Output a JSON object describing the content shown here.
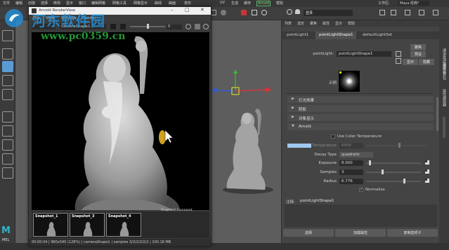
{
  "menubar": {
    "items": [
      "文件",
      "编辑",
      "创建",
      "选择",
      "修改",
      "显示",
      "窗口",
      "编辑网格",
      "网格工具",
      "网格显示",
      "曲线",
      "曲面",
      "变形",
      "UV",
      "生成",
      "缓存",
      "Arnold",
      "帮助"
    ],
    "workspace_label": "工作区:",
    "workspace_value": "Maya 经典*",
    "login_label": "登录"
  },
  "watermark": {
    "site_name": "河东软件园",
    "url": "www.pc0359.cn"
  },
  "render_view": {
    "title": "Arnold RenderView",
    "menus": [
      "File",
      "View",
      "Window",
      "Render"
    ],
    "camera": "cameraShape1",
    "exposure_value": "0",
    "snapshot_comment": "Snapshot Comment",
    "snapshots": [
      "Snapshot_1",
      "Snapshot_3",
      "Snapshot_4"
    ],
    "status_text": "00:00:04 | 960x540 (128%) | cameraShape1 | samples 3/2/2/2/2/2 | 100.18 MB"
  },
  "left_toolbox": {
    "labels": [
      "MEL"
    ]
  },
  "attribute_editor": {
    "top_tabs": [
      "列表",
      "选定",
      "聚焦",
      "属性",
      "显示",
      "帮助"
    ],
    "node_tabs": [
      "pointLight1",
      "pointLightShape1",
      "defaultLightSet"
    ],
    "active_node_tab": "pointLightShape1",
    "node_label": "pointLight:",
    "node_value": "pointLightShape1",
    "focus_button": "聚焦",
    "preset_button": "预设",
    "show_button": "显示",
    "hide_button": "隐藏",
    "sample_label": "示例",
    "sections": [
      "灯光效果",
      "阴影",
      "对象显示",
      "Arnold"
    ],
    "use_color_temperature": "Use Color Temperature",
    "temperature_label": "Temperature",
    "temperature_value": "6500",
    "decay_type_label": "Decay Type",
    "decay_type_value": "quadratic",
    "exposure_label": "Exposure",
    "exposure_value": "8.000",
    "samples_label": "Samples",
    "samples_value": "3",
    "radius_label": "Radius",
    "radius_value": "6.776",
    "normalize_label": "Normalize",
    "notes_label": "注释:",
    "notes_value": "pointLightShape1",
    "bottom_buttons": [
      "选择",
      "加载属性",
      "复制选项卡"
    ]
  },
  "right_strip_tabs": [
    "通道盒/层编辑器",
    "建模工具包",
    "属性编辑器"
  ],
  "colors": {
    "watermark_blue": "#248cd2",
    "watermark_green": "#28a53c",
    "accent_blue": "#5b9bd5"
  }
}
